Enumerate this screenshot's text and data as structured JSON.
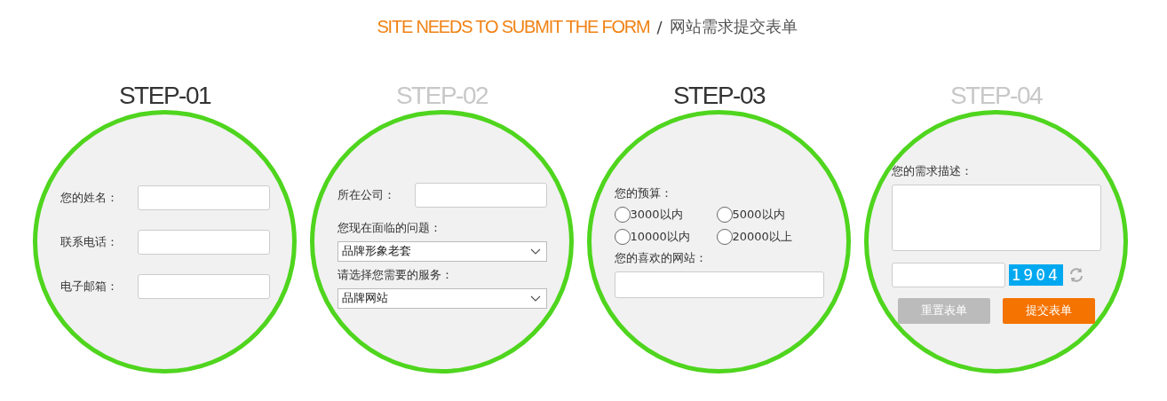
{
  "header": {
    "title_en": "SITE NEEDS TO SUBMIT THE FORM",
    "separator": "/",
    "title_zh": "网站需求提交表单"
  },
  "steps": [
    {
      "label": "STEP-01",
      "active": true,
      "fields": [
        {
          "kind": "inline",
          "label": "您的姓名："
        },
        {
          "kind": "inline",
          "label": "联系电话："
        },
        {
          "kind": "inline",
          "label": "电子邮箱："
        }
      ]
    },
    {
      "label": "STEP-02",
      "active": false,
      "fields": [
        {
          "kind": "inline",
          "label": "所在公司："
        },
        {
          "kind": "select",
          "label": "您现在面临的问题：",
          "value": "品牌形象老套"
        },
        {
          "kind": "select",
          "label": "请选择您需要的服务：",
          "value": "品牌网站"
        }
      ]
    },
    {
      "label": "STEP-03",
      "active": true,
      "fields": [
        {
          "kind": "radios",
          "label": "您的预算：",
          "options": [
            {
              "label": "3000以内",
              "selected": false
            },
            {
              "label": "5000以内",
              "selected": false
            },
            {
              "label": "10000以内",
              "selected": false
            },
            {
              "label": "20000以上",
              "selected": false
            }
          ]
        },
        {
          "kind": "text",
          "label": "您的喜欢的网站："
        }
      ]
    },
    {
      "label": "STEP-04",
      "active": false,
      "fields": [
        {
          "kind": "textarea",
          "label": "您的需求描述："
        },
        {
          "kind": "captcha",
          "code": "1904"
        },
        {
          "kind": "buttons",
          "buttons": [
            {
              "kind": "reset",
              "label": "重置表单"
            },
            {
              "kind": "submit",
              "label": "提交表单"
            }
          ]
        }
      ]
    }
  ]
}
